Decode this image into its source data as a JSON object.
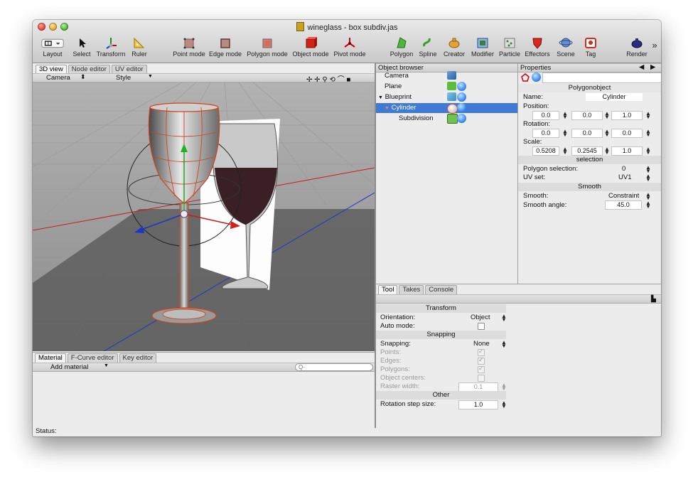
{
  "window": {
    "title": "wineglass - box subdiv.jas"
  },
  "toolbar": {
    "layout": "Layout",
    "select": "Select",
    "transform": "Transform",
    "ruler": "Ruler",
    "point_mode": "Point mode",
    "edge_mode": "Edge mode",
    "polygon_mode": "Polygon mode",
    "object_mode": "Object mode",
    "pivot_mode": "Pivot mode",
    "polygon": "Polygon",
    "spline": "Spline",
    "creator": "Creator",
    "modifier": "Modifier",
    "particle": "Particle",
    "effectors": "Effectors",
    "scene": "Scene",
    "tag": "Tag",
    "render": "Render",
    "overflow": "»"
  },
  "viewport": {
    "tabs": [
      "3D view",
      "Node editor",
      "UV editor"
    ],
    "camera_menu": "Camera",
    "style_menu": "Style"
  },
  "material": {
    "tabs": [
      "Material",
      "F-Curve editor",
      "Key editor"
    ],
    "add_material": "Add material",
    "search_placeholder": "Q-"
  },
  "status": {
    "label": "Status:"
  },
  "object_browser": {
    "header": "Object browser",
    "items": [
      "Camera",
      "Plane",
      "Blueprint",
      "Cylinder",
      "Subdivision"
    ],
    "selected": "Cylinder"
  },
  "properties": {
    "header": "Properties",
    "object_type": "Polygonobject",
    "name_label": "Name:",
    "name_value": "Cylinder",
    "position_label": "Position:",
    "position": [
      "0.0",
      "0.0",
      "1.0"
    ],
    "rotation_label": "Rotation:",
    "rotation": [
      "0.0",
      "0.0",
      "0.0"
    ],
    "scale_label": "Scale:",
    "scale": [
      "0.5208",
      "0.2545",
      "1.0"
    ],
    "selection_section": "selection",
    "polygon_selection_label": "Polygon selection:",
    "polygon_selection_value": "0",
    "uv_set_label": "UV set:",
    "uv_set_value": "UV1",
    "smooth_section": "Smooth",
    "smooth_label": "Smooth:",
    "smooth_value": "Constraint",
    "smooth_angle_label": "Smooth angle:",
    "smooth_angle_value": "45.0"
  },
  "tool_panel": {
    "tabs": [
      "Tool",
      "Takes",
      "Console"
    ],
    "transform_section": "Transform",
    "orientation_label": "Orientation:",
    "orientation_value": "Object",
    "auto_mode_label": "Auto mode:",
    "snapping_section": "Snapping",
    "snapping_label": "Snapping:",
    "snapping_value": "None",
    "points_label": "Points:",
    "edges_label": "Edges:",
    "polygons_label": "Polygons:",
    "object_centers_label": "Object centers:",
    "raster_width_label": "Raster width:",
    "raster_width_value": "0.1",
    "other_section": "Other",
    "rotation_step_label": "Rotation step size:",
    "rotation_step_value": "1.0"
  }
}
